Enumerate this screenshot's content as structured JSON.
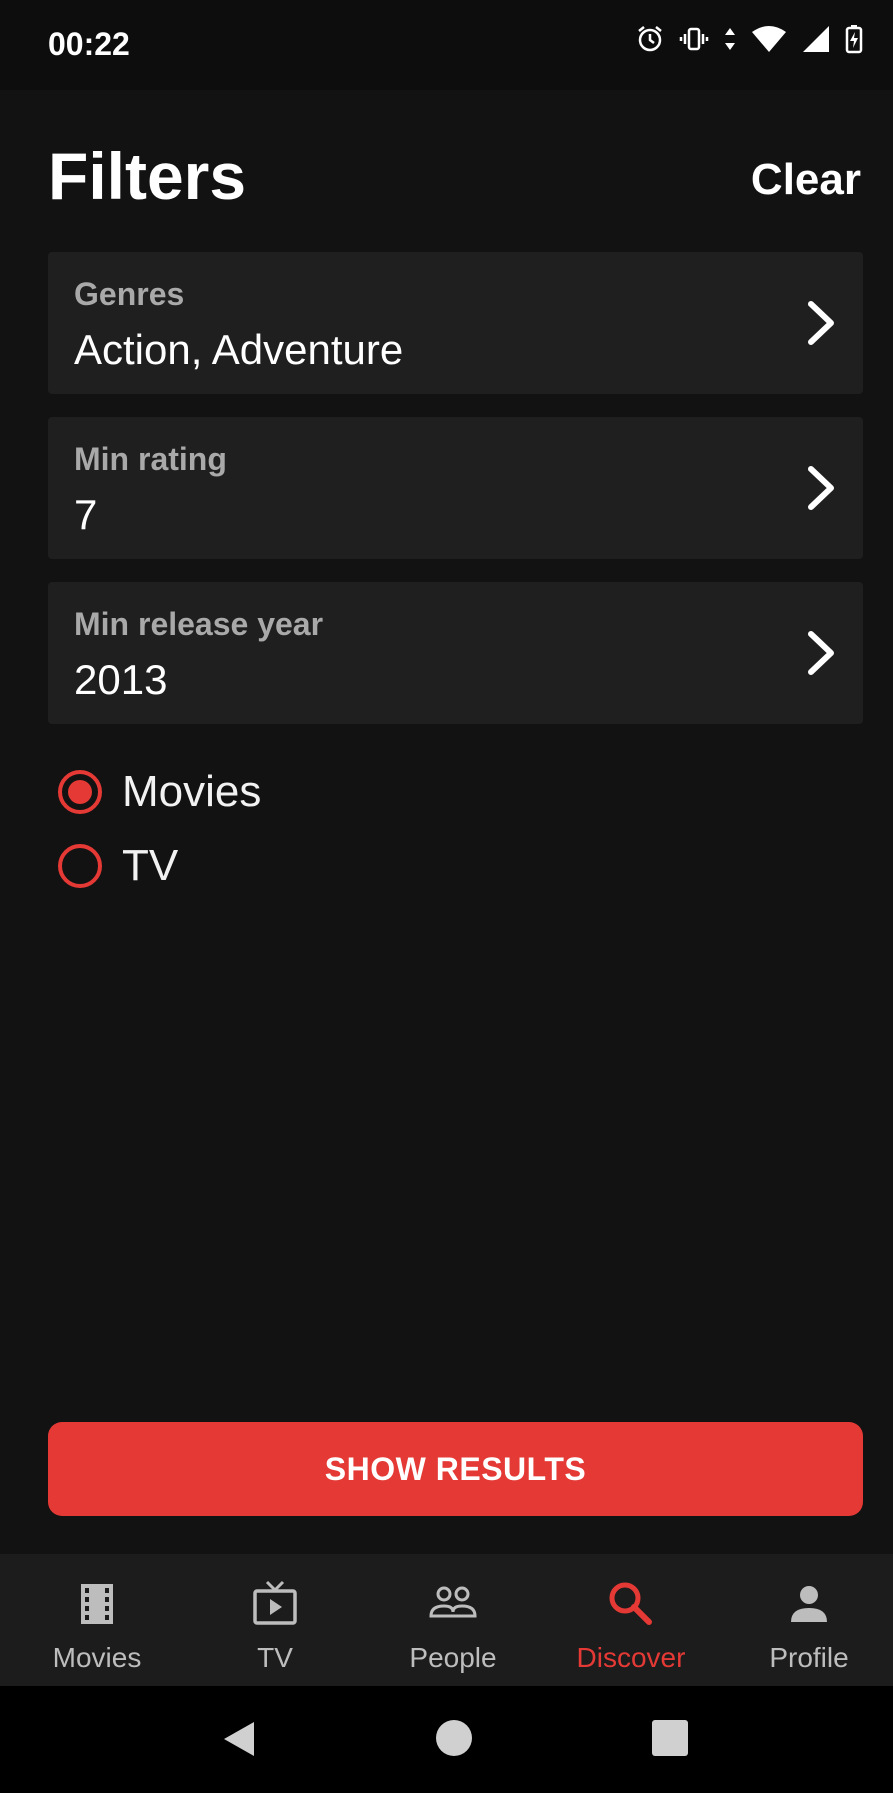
{
  "status_bar": {
    "time": "00:22",
    "icons": [
      "alarm-icon",
      "vibrate-icon",
      "data-arrows-icon",
      "wifi-icon",
      "signal-icon",
      "battery-charging-icon"
    ]
  },
  "header": {
    "title": "Filters",
    "clear_label": "Clear"
  },
  "filters": [
    {
      "label": "Genres",
      "value": "Action, Adventure"
    },
    {
      "label": "Min rating",
      "value": "7"
    },
    {
      "label": "Min release year",
      "value": "2013"
    }
  ],
  "media_type": {
    "options": [
      {
        "label": "Movies",
        "checked": true
      },
      {
        "label": "TV",
        "checked": false
      }
    ]
  },
  "show_results_label": "SHOW RESULTS",
  "bottom_nav": {
    "items": [
      {
        "label": "Movies",
        "icon": "film-icon",
        "active": false
      },
      {
        "label": "TV",
        "icon": "tv-icon",
        "active": false
      },
      {
        "label": "People",
        "icon": "people-icon",
        "active": false
      },
      {
        "label": "Discover",
        "icon": "search-icon",
        "active": true
      },
      {
        "label": "Profile",
        "icon": "person-icon",
        "active": false
      }
    ]
  },
  "colors": {
    "accent": "#e53935",
    "background": "#121212",
    "card": "#1f1f1f",
    "nav_background": "#1c1c1c"
  },
  "system_nav": [
    "back-icon",
    "home-icon",
    "recents-icon"
  ]
}
